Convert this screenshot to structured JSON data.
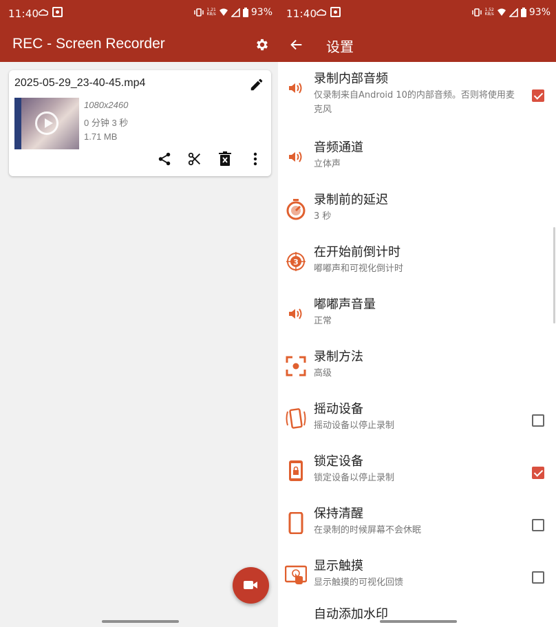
{
  "colors": {
    "accent": "#a8301f",
    "icon_orange": "#e0602f",
    "check_red": "#d9503f"
  },
  "status_bar": {
    "time": "11:40",
    "battery": "93%",
    "speed_left": "1.21",
    "speed_right": "1.52",
    "speed_unit": "KB/s"
  },
  "home": {
    "app_title": "REC - Screen Recorder",
    "recording": {
      "filename": "2025-05-29_23-40-45.mp4",
      "resolution": "1080x2460",
      "duration": "0 分钟 3 秒",
      "size": "1.71 MB"
    }
  },
  "settings": {
    "title": "设置",
    "items": [
      {
        "title": "录制内部音频",
        "subtitle": "仅录制来自Android 10的内部音频。否则将使用麦克风",
        "icon": "speaker-icon",
        "checked": true
      },
      {
        "title": "音频通道",
        "subtitle": "立体声",
        "icon": "speaker-icon",
        "checked": null
      },
      {
        "title": "录制前的延迟",
        "subtitle": "3 秒",
        "icon": "timer-icon",
        "checked": null
      },
      {
        "title": "在开始前倒计时",
        "subtitle": "嘟嘟声和可视化倒计时",
        "icon": "countdown-icon",
        "checked": null
      },
      {
        "title": "嘟嘟声音量",
        "subtitle": "正常",
        "icon": "speaker-icon",
        "checked": null
      },
      {
        "title": "录制方法",
        "subtitle": "高级",
        "icon": "record-method-icon",
        "checked": null
      },
      {
        "title": "摇动设备",
        "subtitle": "摇动设备以停止录制",
        "icon": "shake-icon",
        "checked": false
      },
      {
        "title": "锁定设备",
        "subtitle": "锁定设备以停止录制",
        "icon": "lock-device-icon",
        "checked": true
      },
      {
        "title": "保持清醒",
        "subtitle": "在录制的时候屏幕不会休眠",
        "icon": "phone-icon",
        "checked": false
      },
      {
        "title": "显示触摸",
        "subtitle": "显示触摸的可视化回馈",
        "icon": "touch-icon",
        "checked": false
      }
    ],
    "cutoff_title": "自动添加水印"
  }
}
